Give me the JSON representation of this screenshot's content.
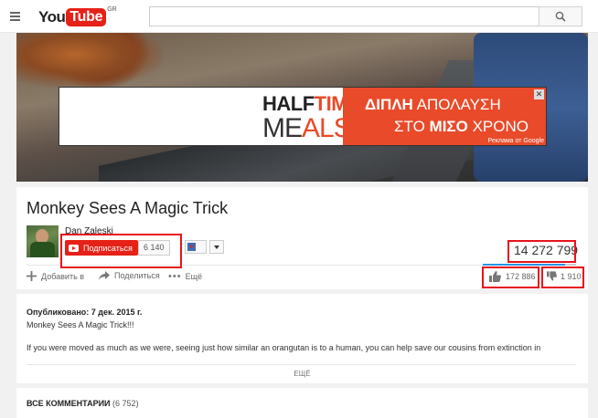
{
  "header": {
    "logo_you": "You",
    "logo_tube": "Tube",
    "logo_region": "GR",
    "search_placeholder": ""
  },
  "ad": {
    "brand_line1_a": "HALF",
    "brand_line1_b": "TIME",
    "brand_line2_a": "ME",
    "brand_line2_b": "ALS",
    "headline1_a": "ΔΙΠΛΗ",
    "headline1_b": " ΑΠΟΛΑΥΣΗ",
    "headline2_a": "ΣΤΟ ",
    "headline2_b": "ΜΙΣΟ",
    "headline2_c": " ΧΡΟΝΟ",
    "ad_label": "Реклама от Google",
    "close_label": "✕"
  },
  "video": {
    "title": "Monkey Sees A Magic Trick",
    "channel": "Dan Zaleski",
    "subscribe_label": "Подписаться",
    "subscriber_count": "6 140",
    "view_count": "14 272 799",
    "add_label": "Добавить в",
    "share_label": "Поделиться",
    "more_label": "Ещё",
    "likes": "172 886",
    "dislikes": "1 910"
  },
  "description": {
    "published": "Опубликовано: 7 дек. 2015 г.",
    "line1": "Monkey Sees A Magic Trick!!!",
    "line2": "If you were moved as much as we were, seeing just how similar an orangutan is to a human, you can help save our cousins from extinction in",
    "show_more": "ЕЩЁ"
  },
  "comments": {
    "title": "ВСЕ КОММЕНТАРИИ",
    "count": "(6 752)"
  },
  "colors": {
    "brand_red": "#e62117",
    "annotation_red": "#e8131b",
    "ad_orange": "#e94a2a",
    "like_bar_blue": "#2793e6"
  }
}
